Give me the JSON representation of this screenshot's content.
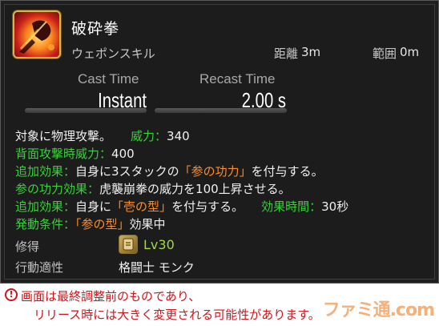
{
  "skill": {
    "name": "破砕拳",
    "type": "ウェポンスキル",
    "range_label": "距離",
    "range_value": "3m",
    "radius_label": "範囲",
    "radius_value": "0m",
    "icon": "fist-strike-icon"
  },
  "timing": {
    "cast_label": "Cast Time",
    "cast_value": "Instant",
    "recast_label": "Recast Time",
    "recast_value": "2.00 s"
  },
  "description": {
    "line1": {
      "text": "対象に物理攻撃。",
      "label": "威力",
      "sep": "：",
      "value": "340"
    },
    "line2": {
      "label": "背面攻撃時威力",
      "sep": "：",
      "value": "400"
    },
    "line3": {
      "label": "追加効果",
      "sep": "：",
      "pre": "自身に3スタックの",
      "highlight": "「参の功力」",
      "post": "を付与する。"
    },
    "line4": {
      "label": "参の功力効果",
      "sep": "：",
      "text": "虎襲崩拳の威力を100上昇させる。"
    },
    "line5": {
      "label": "追加効果",
      "sep": "：",
      "pre": "自身に",
      "highlight": "「壱の型」",
      "post": "を付与する。",
      "label2": "効果時間",
      "sep2": "：",
      "value2": "30秒"
    },
    "line6": {
      "label": "発動条件",
      "sep": "：",
      "highlight": "「参の型」",
      "post": "効果中"
    }
  },
  "acquire": {
    "label": "修得",
    "level": "Lv30",
    "badge_icon": "job-stone-icon"
  },
  "classes": {
    "label": "行動適性",
    "value": "格闘士 モンク"
  },
  "notice": {
    "icon": "exclamation-icon",
    "line1": "画面は最終調整前のものであり、",
    "line2": "リリース時には大きく変更される可能性があります。"
  },
  "watermark": "ファミ通.com",
  "colors": {
    "green": "#38d13a",
    "orange": "#ff8c28",
    "level": "#9fdc3c",
    "notice": "#d0141a"
  }
}
